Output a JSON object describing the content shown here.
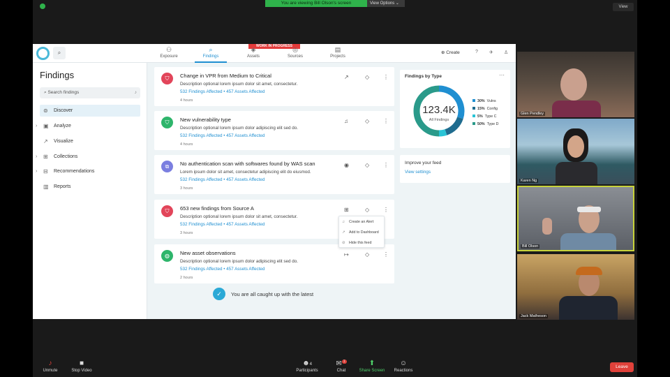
{
  "zoom": {
    "banner": "You are viewing Bill Olson's screen",
    "view_options": "View Options ⌄",
    "view_button": "View",
    "toolbar": {
      "unmute": "Unmute",
      "stop_video": "Stop Video",
      "participants": "Participants",
      "participants_count": "4",
      "chat": "Chat",
      "chat_badge": "1",
      "share_screen": "Share Screen",
      "reactions": "Reactions",
      "leave": "Leave"
    },
    "participants": [
      {
        "name": "Glen Pendley"
      },
      {
        "name": "Karen Ng"
      },
      {
        "name": "Bill Olson"
      },
      {
        "name": "Jack Matheson"
      }
    ]
  },
  "app": {
    "wip_banner": "WORK IN PROGRESS",
    "nav": [
      {
        "label": "Exposure",
        "icon": "exposure-icon"
      },
      {
        "label": "Findings",
        "icon": "findings-icon"
      },
      {
        "label": "Assets",
        "icon": "assets-icon"
      },
      {
        "label": "Sources",
        "icon": "sources-icon"
      },
      {
        "label": "Projects",
        "icon": "projects-icon"
      }
    ],
    "create_label": "Create",
    "sidebar": {
      "title": "Findings",
      "search_placeholder": "Search findings",
      "items": [
        {
          "label": "Discover"
        },
        {
          "label": "Analyze"
        },
        {
          "label": "Visualize"
        },
        {
          "label": "Collections"
        },
        {
          "label": "Recommendations"
        },
        {
          "label": "Reports"
        }
      ]
    },
    "feed": [
      {
        "title": "Change in VPR from Medium to Critical",
        "desc": "Description optional lorem ipsum dolor sit amet, consectetur.",
        "findings": "532 Findings Affected",
        "assets": "457 Assets Affected",
        "time": "4 hours",
        "badge_color": "#e2455a"
      },
      {
        "title": "New vulnerability type",
        "desc": "Description optional lorem ipsum dolor adipiscing elit sed do.",
        "findings": "532 Findings Affected",
        "assets": "457 Assets Affected",
        "time": "4 hours",
        "badge_color": "#2eb56b"
      },
      {
        "title": "No authentication scan with softwares found by WAS scan",
        "desc": "Lorem ipsum dolor sit amet, consectetur adipiscing elit do eiusmod.",
        "findings": "532 Findings Affected",
        "assets": "457 Assets Affected",
        "time": "3 hours",
        "badge_color": "#7b7fe0"
      },
      {
        "title": "653 new findings from Source A",
        "desc": "Description optional lorem ipsum dolor sit amet, consectetur.",
        "findings": "532 Findings Affected",
        "assets": "457 Assets Affected",
        "time": "3 hours",
        "badge_color": "#e2455a"
      },
      {
        "title": "New asset observations",
        "desc": "Description optional lorem ipsum dolor adipiscing elit sed do.",
        "findings": "532 Findings Affected",
        "assets": "457 Assets Affected",
        "time": "2 hours",
        "badge_color": "#2eb56b"
      }
    ],
    "caught_up": "You are all caught up with the latest",
    "context_menu": {
      "items": [
        "Create an Alert",
        "Add to Dashboard",
        "Hide this feed"
      ]
    },
    "findings_by_type": {
      "title": "Findings by Type",
      "total": "123.4K",
      "total_label": "All Findings",
      "legend": [
        {
          "pct": "30%",
          "label": "Vulns",
          "value": 30,
          "color": "#1f8fd1"
        },
        {
          "pct": "15%",
          "label": "Config",
          "value": 15,
          "color": "#1f6c8f"
        },
        {
          "pct": "5%",
          "label": "Type C",
          "value": 5,
          "color": "#29c4d6"
        },
        {
          "pct": "50%",
          "label": "Type D",
          "value": 50,
          "color": "#2a9a8a"
        }
      ]
    },
    "improve_feed": {
      "title": "Improve your feed",
      "link": "View settings"
    }
  }
}
